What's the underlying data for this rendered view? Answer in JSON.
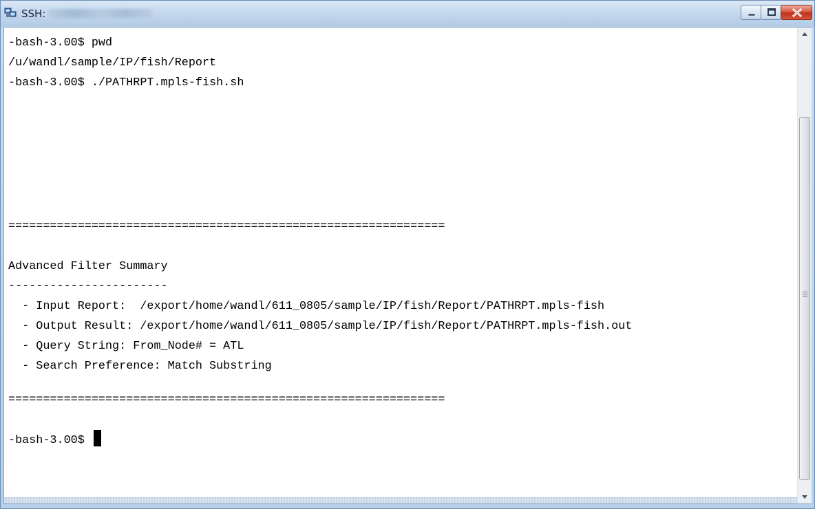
{
  "window": {
    "title": "SSH:",
    "title_hidden_note": "",
    "icon": "terminal-app-icon",
    "buttons": [
      "minimize-icon",
      "maximize-icon",
      "close-icon"
    ]
  },
  "terminal": {
    "lines": [
      "-bash-3.00$ pwd",
      "/u/wandl/sample/IP/fish/Report",
      "-bash-3.00$ ./PATHRPT.mpls-fish.sh",
      "",
      "",
      "",
      "",
      "",
      "===============================================================",
      "",
      "Advanced Filter Summary",
      "-----------------------",
      "  - Input Report:  /export/home/wandl/611_0805/sample/IP/fish/Report/PATHRPT.mpls-fish",
      "  - Output Result: /export/home/wandl/611_0805/sample/IP/fish/Report/PATHRPT.mpls-fish.out",
      "  - Query String: From_Node# = ATL",
      "  - Search Preference: Match Substring",
      "",
      "===============================================================",
      "",
      "-bash-3.00$ "
    ],
    "prompt": "-bash-3.00$ "
  },
  "colors": {
    "terminal_bg": "#ffffff",
    "terminal_fg": "#000000",
    "titlebar": "#c4d8ee",
    "close_button": "#c0311b"
  }
}
